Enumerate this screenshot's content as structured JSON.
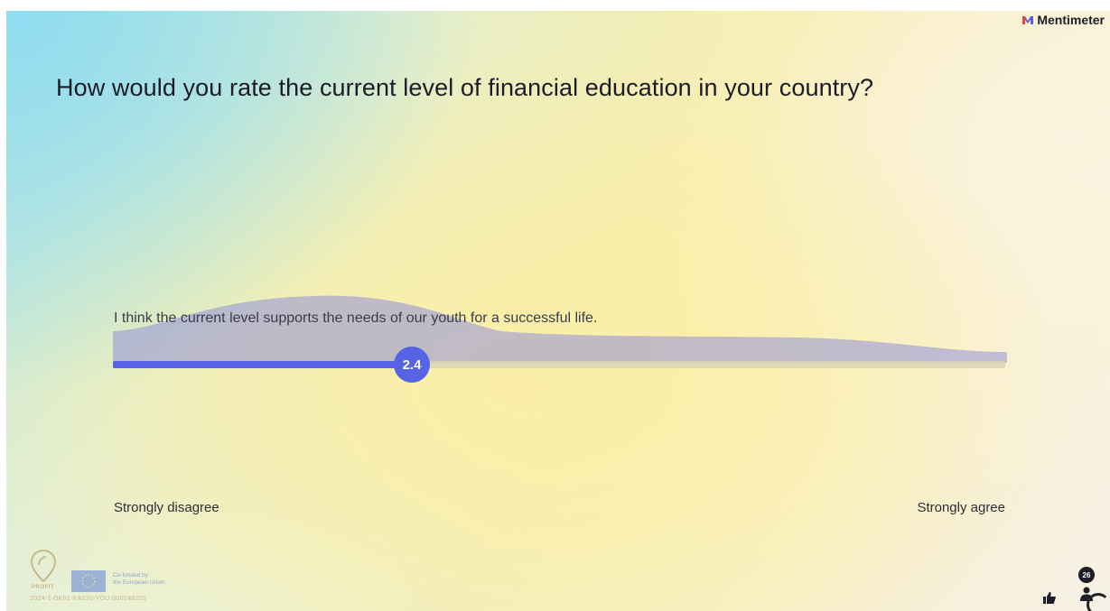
{
  "brand": {
    "name": "Mentimeter",
    "icon": "mentimeter-logo-icon"
  },
  "question": {
    "title": "How would you rate the current level of financial education in your country?"
  },
  "scale": {
    "statement": "I think the current level supports the needs of our youth for a successful life.",
    "average_display": "2.4",
    "average_fraction": 0.335,
    "min_label": "Strongly disagree",
    "max_label": "Strongly agree",
    "fill_color": "#5563e4"
  },
  "footer": {
    "project_name": "PROFIT",
    "cofunded_line1": "Co-funded by",
    "cofunded_line2": "the European Union",
    "grant_code": "2024-1-DK01-KA220-YOU-000248201"
  },
  "reactions": {
    "like_icon": "thumbs-up-icon"
  },
  "participants": {
    "count": "26",
    "icon": "person-icon"
  }
}
